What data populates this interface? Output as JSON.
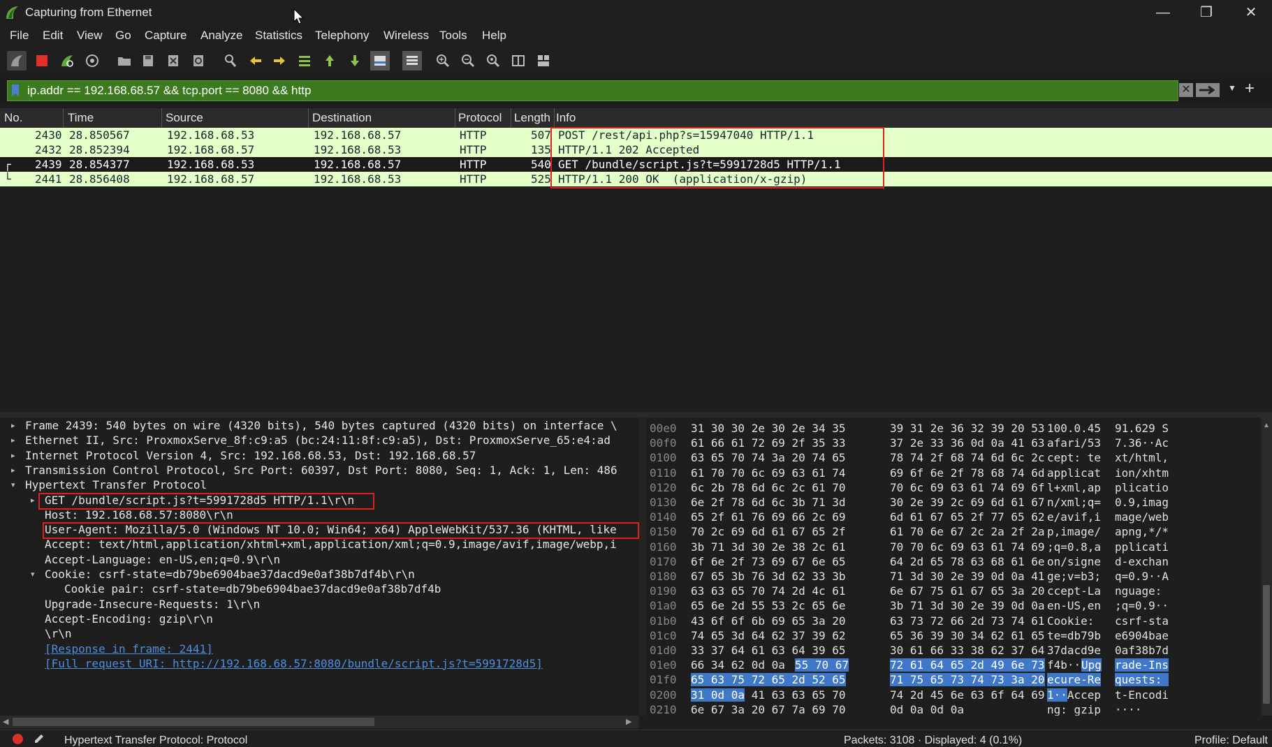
{
  "window": {
    "title": "Capturing from Ethernet",
    "minimize_glyph": "—",
    "restore_glyph": "❐",
    "close_glyph": "✕"
  },
  "menu": [
    "File",
    "Edit",
    "View",
    "Go",
    "Capture",
    "Analyze",
    "Statistics",
    "Telephony",
    "Wireless",
    "Tools",
    "Help"
  ],
  "toolbar_icons": [
    "shark-fin-start-icon",
    "stop-capture-icon",
    "restart-capture-icon",
    "capture-options-icon",
    "open-file-icon",
    "save-file-icon",
    "close-file-icon",
    "reload-file-icon",
    "find-packet-icon",
    "go-back-icon",
    "go-forward-icon",
    "go-to-packet-icon",
    "go-first-icon",
    "go-last-icon",
    "auto-scroll-icon",
    "colorize-icon",
    "zoom-in-icon",
    "zoom-out-icon",
    "zoom-reset-icon",
    "resize-columns-icon",
    "layout-icon"
  ],
  "filter": {
    "value": "ip.addr == 192.168.68.57 && tcp.port == 8080 && http"
  },
  "packet_list": {
    "columns": [
      "No.",
      "Time",
      "Source",
      "Destination",
      "Protocol",
      "Length",
      "Info"
    ],
    "rows": [
      {
        "no": "2430",
        "time": "28.850567",
        "src": "192.168.68.53",
        "dst": "192.168.68.57",
        "proto": "HTTP",
        "len": "507",
        "info": "POST /rest/api.php?s=15947040 HTTP/1.1",
        "marker": ""
      },
      {
        "no": "2432",
        "time": "28.852394",
        "src": "192.168.68.57",
        "dst": "192.168.68.53",
        "proto": "HTTP",
        "len": "135",
        "info": "HTTP/1.1 202 Accepted",
        "marker": ""
      },
      {
        "no": "2439",
        "time": "28.854377",
        "src": "192.168.68.53",
        "dst": "192.168.68.57",
        "proto": "HTTP",
        "len": "540",
        "info": "GET /bundle/script.js?t=5991728d5 HTTP/1.1",
        "marker": "┌"
      },
      {
        "no": "2441",
        "time": "28.856408",
        "src": "192.168.68.57",
        "dst": "192.168.68.53",
        "proto": "HTTP",
        "len": "525",
        "info": "HTTP/1.1 200 OK  (application/x-gzip)",
        "marker": "└"
      }
    ]
  },
  "details": [
    {
      "text": "Frame 2439: 540 bytes on wire (4320 bits), 540 bytes captured (4320 bits) on interface \\",
      "indent": 0,
      "arrow": "▸"
    },
    {
      "text": "Ethernet II, Src: ProxmoxServe_8f:c9:a5 (bc:24:11:8f:c9:a5), Dst: ProxmoxServe_65:e4:ad",
      "indent": 0,
      "arrow": "▸"
    },
    {
      "text": "Internet Protocol Version 4, Src: 192.168.68.53, Dst: 192.168.68.57",
      "indent": 0,
      "arrow": "▸"
    },
    {
      "text": "Transmission Control Protocol, Src Port: 60397, Dst Port: 8080, Seq: 1, Ack: 1, Len: 486",
      "indent": 0,
      "arrow": "▸"
    },
    {
      "text": "Hypertext Transfer Protocol",
      "indent": 0,
      "arrow": "▾"
    },
    {
      "text": "GET /bundle/script.js?t=5991728d5 HTTP/1.1\\r\\n",
      "indent": 1,
      "arrow": "▸"
    },
    {
      "text": "Host: 192.168.68.57:8080\\r\\n",
      "indent": 1,
      "arrow": ""
    },
    {
      "text": "User-Agent: Mozilla/5.0 (Windows NT 10.0; Win64; x64) AppleWebKit/537.36 (KHTML, like",
      "indent": 1,
      "arrow": ""
    },
    {
      "text": "Accept: text/html,application/xhtml+xml,application/xml;q=0.9,image/avif,image/webp,i",
      "indent": 1,
      "arrow": ""
    },
    {
      "text": "Accept-Language: en-US,en;q=0.9\\r\\n",
      "indent": 1,
      "arrow": ""
    },
    {
      "text": "Cookie: csrf-state=db79be6904bae37dacd9e0af38b7df4b\\r\\n",
      "indent": 1,
      "arrow": "▾"
    },
    {
      "text": "Cookie pair: csrf-state=db79be6904bae37dacd9e0af38b7df4b",
      "indent": 2,
      "arrow": ""
    },
    {
      "text": "Upgrade-Insecure-Requests: 1\\r\\n",
      "indent": 1,
      "arrow": ""
    },
    {
      "text": "Accept-Encoding: gzip\\r\\n",
      "indent": 1,
      "arrow": ""
    },
    {
      "text": "\\r\\n",
      "indent": 1,
      "arrow": ""
    },
    {
      "text": "[Response in frame: 2441]",
      "indent": 1,
      "arrow": "",
      "link": true
    },
    {
      "text": "[Full request URI: http://192.168.68.57:8080/bundle/script.js?t=5991728d5]",
      "indent": 1,
      "arrow": "",
      "link": true
    }
  ],
  "bytes": [
    {
      "off": "00e0",
      "h1": "31 30 30 2e 30 2e 34 35",
      "h2": "39 31 2e 36 32 39 20 53",
      "a1": "100.0.45",
      "a2": "91.629 S"
    },
    {
      "off": "00f0",
      "h1": "61 66 61 72 69 2f 35 33",
      "h2": "37 2e 33 36 0d 0a 41 63",
      "a1": "afari/53",
      "a2": "7.36··Ac"
    },
    {
      "off": "0100",
      "h1": "63 65 70 74 3a 20 74 65",
      "h2": "78 74 2f 68 74 6d 6c 2c",
      "a1": "cept: te",
      "a2": "xt/html,"
    },
    {
      "off": "0110",
      "h1": "61 70 70 6c 69 63 61 74",
      "h2": "69 6f 6e 2f 78 68 74 6d",
      "a1": "applicat",
      "a2": "ion/xhtm"
    },
    {
      "off": "0120",
      "h1": "6c 2b 78 6d 6c 2c 61 70",
      "h2": "70 6c 69 63 61 74 69 6f",
      "a1": "l+xml,ap",
      "a2": "plicatio"
    },
    {
      "off": "0130",
      "h1": "6e 2f 78 6d 6c 3b 71 3d",
      "h2": "30 2e 39 2c 69 6d 61 67",
      "a1": "n/xml;q=",
      "a2": "0.9,imag"
    },
    {
      "off": "0140",
      "h1": "65 2f 61 76 69 66 2c 69",
      "h2": "6d 61 67 65 2f 77 65 62",
      "a1": "e/avif,i",
      "a2": "mage/web"
    },
    {
      "off": "0150",
      "h1": "70 2c 69 6d 61 67 65 2f",
      "h2": "61 70 6e 67 2c 2a 2f 2a",
      "a1": "p,image/",
      "a2": "apng,*/*"
    },
    {
      "off": "0160",
      "h1": "3b 71 3d 30 2e 38 2c 61",
      "h2": "70 70 6c 69 63 61 74 69",
      "a1": ";q=0.8,a",
      "a2": "pplicati"
    },
    {
      "off": "0170",
      "h1": "6f 6e 2f 73 69 67 6e 65",
      "h2": "64 2d 65 78 63 68 61 6e",
      "a1": "on/signe",
      "a2": "d-exchan"
    },
    {
      "off": "0180",
      "h1": "67 65 3b 76 3d 62 33 3b",
      "h2": "71 3d 30 2e 39 0d 0a 41",
      "a1": "ge;v=b3;",
      "a2": "q=0.9··A"
    },
    {
      "off": "0190",
      "h1": "63 63 65 70 74 2d 4c 61",
      "h2": "6e 67 75 61 67 65 3a 20",
      "a1": "ccept-La",
      "a2": "nguage: "
    },
    {
      "off": "01a0",
      "h1": "65 6e 2d 55 53 2c 65 6e",
      "h2": "3b 71 3d 30 2e 39 0d 0a",
      "a1": "en-US,en",
      "a2": ";q=0.9··"
    },
    {
      "off": "01b0",
      "h1": "43 6f 6f 6b 69 65 3a 20",
      "h2": "63 73 72 66 2d 73 74 61",
      "a1": "Cookie: ",
      "a2": "csrf-sta"
    },
    {
      "off": "01c0",
      "h1": "74 65 3d 64 62 37 39 62",
      "h2": "65 36 39 30 34 62 61 65",
      "a1": "te=db79b",
      "a2": "e6904bae"
    },
    {
      "off": "01d0",
      "h1": "33 37 64 61 63 64 39 65",
      "h2": "30 61 66 33 38 62 37 64",
      "a1": "37dacd9e",
      "a2": "0af38b7d"
    },
    {
      "off": "01e0",
      "h1": "66 34 62 0d 0a 55 70 67",
      "h2": "72 61 64 65 2d 49 6e 73",
      "a1": "f4b··Upg",
      "a2": "rade-Ins"
    },
    {
      "off": "01f0",
      "h1": "65 63 75 72 65 2d 52 65",
      "h2": "71 75 65 73 74 73 3a 20",
      "a1": "ecure-Re",
      "a2": "quests: "
    },
    {
      "off": "0200",
      "h1": "31 0d 0a 41 63 63 65 70",
      "h2": "74 2d 45 6e 63 6f 64 69",
      "a1": "1··Accep",
      "a2": "t-Encodi"
    },
    {
      "off": "0210",
      "h1": "6e 67 3a 20 67 7a 69 70",
      "h2": "0d 0a 0d 0a",
      "a1": "ng: gzip",
      "a2": "····"
    }
  ],
  "status": {
    "left": "Hypertext Transfer Protocol: Protocol",
    "middle": "Packets: 3108 · Displayed: 4 (0.1%)",
    "right": "Profile: Default"
  }
}
